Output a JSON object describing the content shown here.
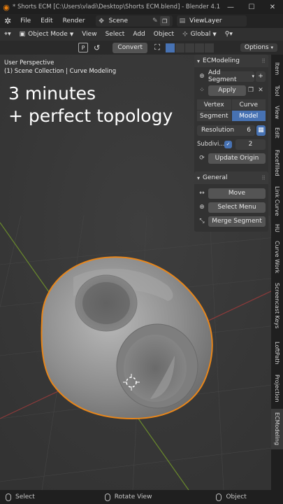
{
  "window": {
    "title": "* Shorts ECM [C:\\Users\\vladi\\Desktop\\Shorts ECM.blend] - Blender 4.1",
    "minimize": "—",
    "maximize": "☐",
    "close": "✕"
  },
  "menubar": {
    "items": [
      "File",
      "Edit",
      "Render"
    ],
    "scene": "Scene",
    "view_layer": "ViewLayer"
  },
  "header": {
    "mode": "Object Mode",
    "menus": [
      "View",
      "Select",
      "Add",
      "Object"
    ],
    "orientation": "Global"
  },
  "toolhdr": {
    "key": "P",
    "convert": "Convert",
    "options": "Options"
  },
  "viewport": {
    "perspective": "User Perspective",
    "collection": "(1) Scene Collection | Curve Modeling",
    "caption_line1": "3 minutes",
    "caption_line2": "+ perfect topology"
  },
  "ecmodeling": {
    "title": "ECModeling",
    "add_segment": "Add Segment",
    "apply": "Apply",
    "vertex": "Vertex",
    "curve": "Curve",
    "segment": "Segment",
    "model": "Model",
    "resolution_label": "Resolution",
    "resolution_value": "6",
    "subdiv_label": "Subdivi...",
    "subdiv_value": "2",
    "update_origin": "Update Origin"
  },
  "general": {
    "title": "General",
    "move": "Move",
    "select_menu": "Select Menu",
    "merge_segment": "Merge Segment"
  },
  "tabs": [
    "Item",
    "Tool",
    "View",
    "Edit",
    "Facefilled",
    "Link Curve",
    "HU",
    "Curve Work",
    "Screencast Keys",
    "LoftPath",
    "Projection",
    "ECModeling"
  ],
  "statusbar": {
    "select": "Select",
    "rotate": "Rotate View",
    "object": "Object"
  },
  "colors": {
    "accent_blue": "#4772b3",
    "selection_orange": "#e8861a",
    "axis_red": "#9e3a3a",
    "axis_green": "#6c8c2a"
  }
}
